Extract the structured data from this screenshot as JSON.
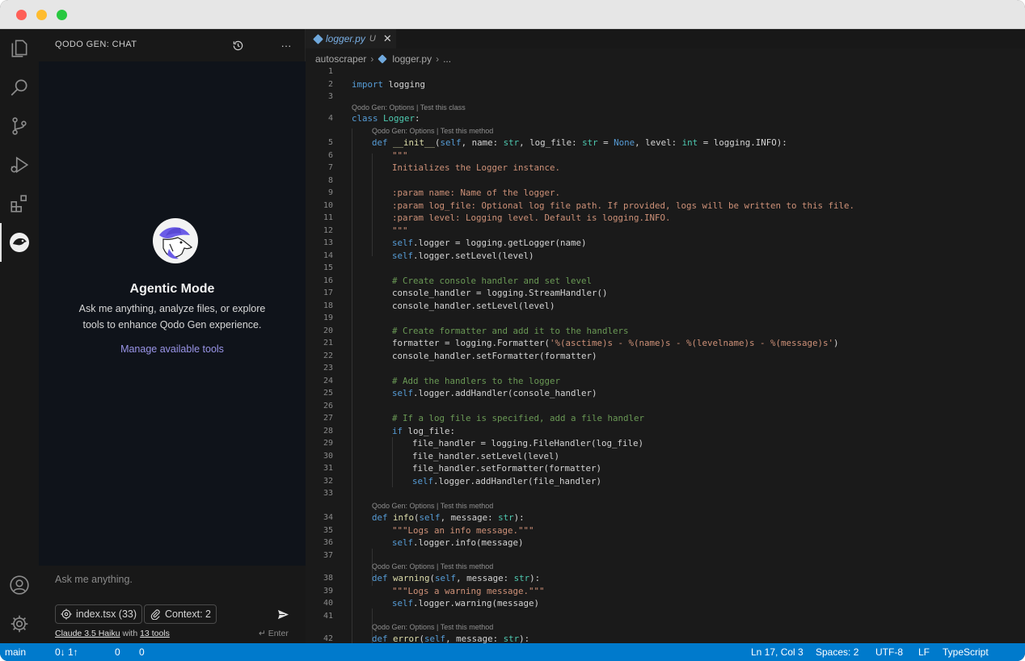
{
  "colors": {
    "status_bar": "#007acc",
    "accent_link": "#9a95e8",
    "logo_purple": "#6b5ce7",
    "keyword": "#569cd6",
    "string": "#ce9178",
    "comment": "#6a9955"
  },
  "activity_bar": {
    "icons": [
      "files-icon",
      "search-icon",
      "source-control-icon",
      "run-debug-icon",
      "extensions-icon",
      "qodo-icon",
      "account-icon",
      "settings-gear-icon"
    ]
  },
  "sidebar": {
    "title": "QODO GEN: CHAT",
    "history_icon": "history-icon",
    "more_icon": "more-icon",
    "more_label": "···",
    "empty_state": {
      "title": "Agentic Mode",
      "description": "Ask me anything, analyze files, or explore tools to enhance Qodo Gen experience.",
      "link": "Manage available tools"
    },
    "input": {
      "placeholder": "Ask me anything.",
      "chip_file": "index.tsx (33)",
      "chip_context": "Context: 2",
      "model": "Claude 3.5 Haiku",
      "with": "with",
      "tools": "13 tools",
      "enter_hint": "↵ Enter"
    }
  },
  "editor": {
    "tab": {
      "name": "logger.py",
      "modified": "U",
      "close": "✕"
    },
    "breadcrumb": {
      "folder": "autoscraper",
      "file": "logger.py",
      "more": "..."
    },
    "lens_class": "Qodo Gen: Options | Test this class",
    "lens_method": "Qodo Gen: Options | Test this method",
    "lines": {
      "l2": {
        "kw": "import",
        "rest": " logging"
      },
      "l4": {
        "kw": "class",
        "name": " Logger",
        "rest": ":"
      },
      "l5": {
        "kw": "def",
        "fn": " __init__",
        "a": "(",
        "self": "self",
        "b": ", name: ",
        "t1": "str",
        "c": ", log_file: ",
        "t2": "str",
        "d": " = ",
        "none": "None",
        "e": ", level: ",
        "t3": "int",
        "f": " = logging.INFO):"
      },
      "l6": "\"\"\"",
      "l7": "Initializes the Logger instance.",
      "l9": ":param name: Name of the logger.",
      "l10": ":param log_file: Optional log file path. If provided, logs will be written to this file.",
      "l11": ":param level: Logging level. Default is logging.INFO.",
      "l12": "\"\"\"",
      "l13": {
        "self": "self",
        "rest": ".logger = logging.getLogger(name)"
      },
      "l14": {
        "self": "self",
        "rest": ".logger.setLevel(level)"
      },
      "l16": "# Create console handler and set level",
      "l17": "console_handler = logging.StreamHandler()",
      "l18": "console_handler.setLevel(level)",
      "l20": "# Create formatter and add it to the handlers",
      "l21": {
        "a": "formatter = logging.Formatter(",
        "str": "'%(asctime)s - %(name)s - %(levelname)s - %(message)s'",
        "b": ")"
      },
      "l22": "console_handler.setFormatter(formatter)",
      "l24": "# Add the handlers to the logger",
      "l25": {
        "self": "self",
        "rest": ".logger.addHandler(console_handler)"
      },
      "l27": "# If a log file is specified, add a file handler",
      "l28": {
        "kw": "if",
        "rest": " log_file:"
      },
      "l29": "file_handler = logging.FileHandler(log_file)",
      "l30": "file_handler.setLevel(level)",
      "l31": "file_handler.setFormatter(formatter)",
      "l32": {
        "self": "self",
        "rest": ".logger.addHandler(file_handler)"
      },
      "l34": {
        "kw": "def",
        "fn": " info",
        "a": "(",
        "self": "self",
        "b": ", message: ",
        "t": "str",
        "c": "):"
      },
      "l35": "\"\"\"Logs an info message.\"\"\"",
      "l36": {
        "self": "self",
        "rest": ".logger.info(message)"
      },
      "l38": {
        "kw": "def",
        "fn": " warning",
        "a": "(",
        "self": "self",
        "b": ", message: ",
        "t": "str",
        "c": "):"
      },
      "l39": "\"\"\"Logs a warning message.\"\"\"",
      "l40": {
        "self": "self",
        "rest": ".logger.warning(message)"
      },
      "l42": {
        "kw": "def",
        "fn": " error",
        "a": "(",
        "self": "self",
        "b": ", message: ",
        "t": "str",
        "c": "):"
      }
    },
    "line_numbers": [
      "1",
      "2",
      "3",
      "4",
      "5",
      "6",
      "7",
      "8",
      "9",
      "10",
      "11",
      "12",
      "13",
      "14",
      "15",
      "16",
      "17",
      "18",
      "19",
      "20",
      "21",
      "22",
      "23",
      "24",
      "25",
      "26",
      "27",
      "28",
      "29",
      "30",
      "31",
      "32",
      "33",
      "34",
      "35",
      "36",
      "37",
      "38",
      "39",
      "40",
      "41",
      "42"
    ]
  },
  "status_bar": {
    "branch": "main",
    "sync": "0↓ 1↑",
    "errors": "0",
    "warnings": "0",
    "cursor": "Ln 17, Col 3",
    "spaces": "Spaces: 2",
    "encoding": "UTF-8",
    "eol": "LF",
    "language": "TypeScript"
  }
}
